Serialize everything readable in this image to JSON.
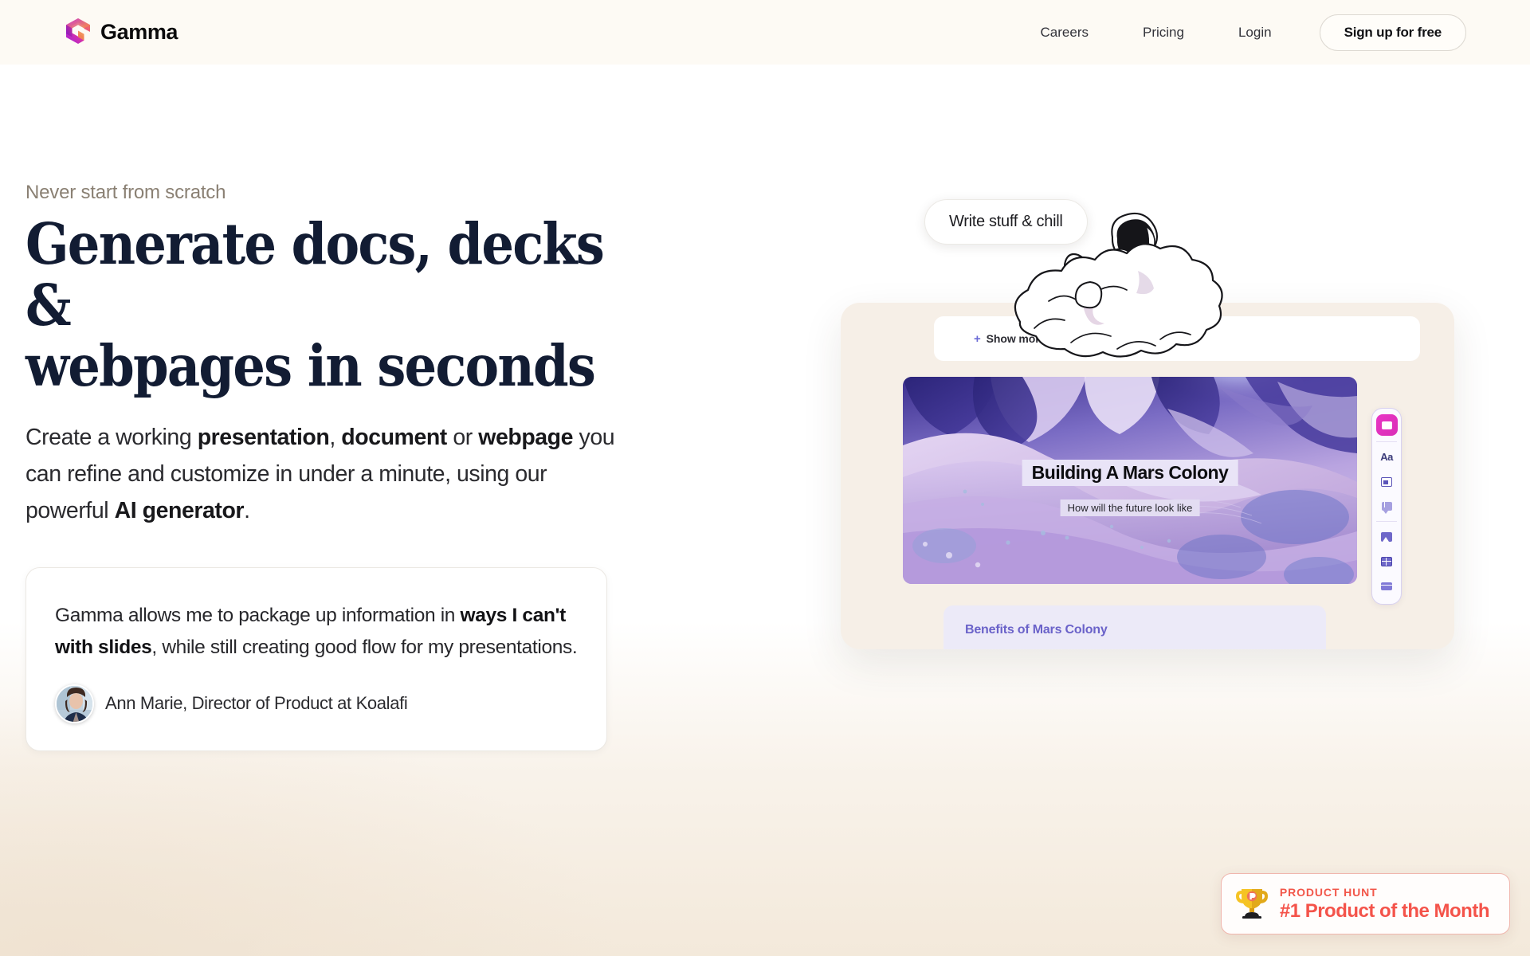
{
  "header": {
    "brand": {
      "name": "Gamma",
      "logo_icon": "gamma-cube-logo-icon"
    },
    "nav_links": [
      {
        "label": "Careers"
      },
      {
        "label": "Pricing"
      },
      {
        "label": "Login"
      }
    ],
    "cta": {
      "label": "Sign up for free"
    },
    "background_color": "#fdfaf4"
  },
  "hero": {
    "eyebrow": "Never start from scratch",
    "headline": "Generate docs, decks &\nwebpages in seconds",
    "headline_color": "#121c33",
    "subcopy": {
      "part1": "Create a working ",
      "bold1": "presentation",
      "part2": ", ",
      "bold2": "document",
      "part3": " or ",
      "bold3": "webpage",
      "part4": " you can refine and customize in under a minute, using our powerful ",
      "bold4": "AI generator",
      "part5": "."
    }
  },
  "testimonial": {
    "quote_part1": "Gamma allows me to package up information in ",
    "quote_bold": "ways I can't with slides",
    "quote_part2": ", while still creating good flow for my presentations.",
    "attribution": "Ann Marie, Director of Product at Koalafi",
    "avatar_icon": "user-avatar"
  },
  "product_mock": {
    "chip_label": "Write stuff & chill",
    "show_more_label": "Show more",
    "show_more_plus": "+",
    "astronaut_icon": "astronaut-on-cloud-illustration",
    "slide": {
      "title": "Building A Mars Colony",
      "subtitle": "How will the future look like",
      "image_description": "mars-landscape-image"
    },
    "bottom_section_label": "Benefits of Mars Colony",
    "bottom_section_color": "#6a62c9",
    "toolbar": {
      "items": [
        {
          "name": "card-tool",
          "icon": "card-icon",
          "active": true
        },
        {
          "name": "text-tool",
          "icon": "text-aa-icon",
          "label": "Aa"
        },
        {
          "name": "layout-tool",
          "icon": "layout-box-icon"
        },
        {
          "name": "callout-tool",
          "icon": "callout-icon"
        },
        {
          "name": "image-tool",
          "icon": "image-icon"
        },
        {
          "name": "video-tool",
          "icon": "video-icon"
        },
        {
          "name": "embed-tool",
          "icon": "embed-icon"
        }
      ],
      "accent_color": "#e935c5"
    }
  },
  "product_hunt_badge": {
    "kicker": "PRODUCT HUNT",
    "title": "#1 Product of the Month",
    "icon": "trophy-icon",
    "accent_color": "#f4534a"
  }
}
